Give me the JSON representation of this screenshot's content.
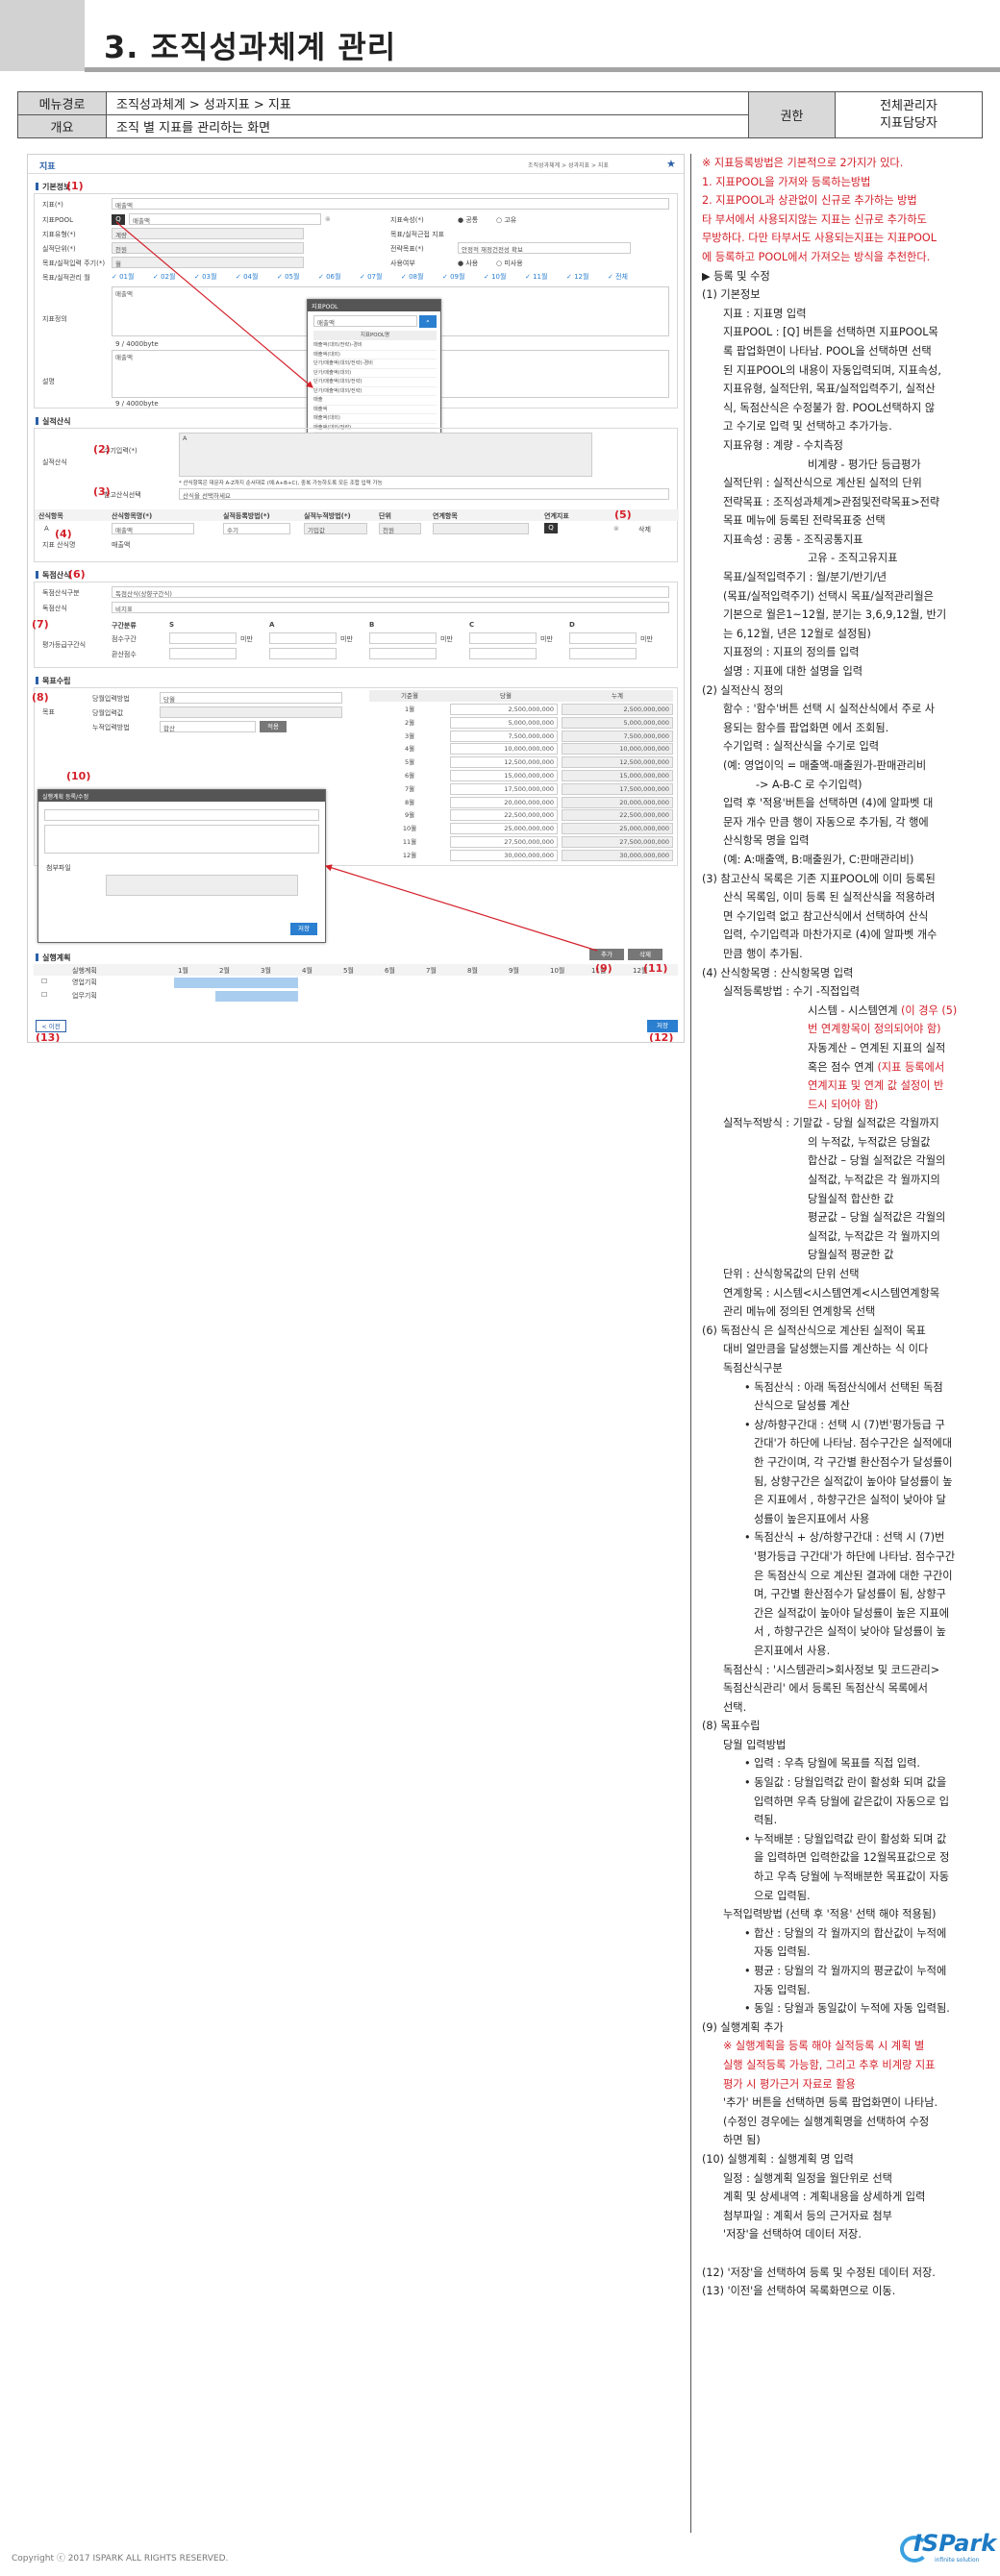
{
  "header": {
    "title": "3. 조직성과체계 관리"
  },
  "meta": {
    "path_label": "메뉴경로",
    "path_value": "조직성과체계 > 성과지표 > 지표",
    "overview_label": "개요",
    "overview_value": "조직 별 지표를 관리하는 화면",
    "auth_label": "권한",
    "auth_value_1": "전체관리자",
    "auth_value_2": "지표담당자"
  },
  "screen": {
    "title": "지표",
    "breadcrumb": "조직성과체계  >  성과지표  >  지표",
    "sections": {
      "basic": "기본정보",
      "calc": "실적산식",
      "formula": "독점산식",
      "goal": "목표수립",
      "plan": "실행계획"
    },
    "basic": {
      "kpi_label": "지표(*)",
      "kpi_value": "매출액",
      "pool_label": "지표POOL",
      "pool_value": "매출액",
      "type_label": "지표유형(*)",
      "type_value": "계량",
      "unit_label": "실적단위(*)",
      "unit_value": "천원",
      "cycle_label": "목표/실적입력 주기(*)",
      "cycle_value": "월",
      "months_label": "목표/실적관리 월",
      "months": [
        "01월",
        "02월",
        "03월",
        "04월",
        "05월",
        "06월",
        "07월",
        "08월",
        "09월",
        "10월",
        "11월",
        "12월",
        "전체"
      ],
      "attr_label": "지표속성(*)",
      "attr_opt1": "공통",
      "attr_opt2": "고유",
      "goal_kpi_label": "목표/실적근접 지표",
      "strategy_label": "전략목표(*)",
      "strategy_value": "안정적 재정건전성 확보",
      "use_label": "사용여부",
      "use_opt1": "사용",
      "use_opt2": "미사용",
      "def_label": "지표정의",
      "def_value": "매출액",
      "def_count": "9 / 4000byte",
      "desc_label": "설명",
      "desc_value": "매출액",
      "desc_count": "9 / 4000byte"
    },
    "pool_popup": {
      "title": "지표POOL",
      "search": "매출액",
      "col": "지표POOL명",
      "rows": [
        "매출액(대외/전략)-경비",
        "매출액(대외)",
        "단가/매출액(대외/전략)-경비",
        "단가/매출액(대외)",
        "단가/매출액(대외/전략)",
        "단가/매출액(대외/전략)",
        "매출",
        "매출액",
        "매출액(대외)",
        "매출액(대외/전략)",
        "매출액(전략)",
        "매출액증가율",
        "매출원가",
        "매출총이익"
      ]
    },
    "calc": {
      "calc_label": "실적산식",
      "calc_num": "(2)",
      "calc_sublabel": "수기입력(*)",
      "calc_value": "A",
      "calc_note": "* 산식항목은 대문자 A-Z까지 순서대로 (예:A+B+C), 중복 가능하도록 모든 조합 입력 가능",
      "ref_sublabel": "참고산식선택",
      "ref_value": "산식을 선택하세요",
      "headers": [
        "산식항목",
        "산식항목명(*)",
        "실적등록방법(*)",
        "실적누적방법(*)",
        "단위",
        "연계항목",
        "연계지표"
      ],
      "row": [
        "A",
        "매출액",
        "수기",
        "기입값",
        "천원",
        "",
        "",
        "삭제"
      ],
      "unit_label": "지표 산식명",
      "unit_value": "매출액"
    },
    "formula": {
      "type_label": "독점산식구분",
      "type_value": "독점산식(상향구간식)",
      "name_label": "독점산식",
      "name_value": "비지표",
      "band_label": "평가등급구간식",
      "band_cols": [
        "구간분류",
        "S",
        "A",
        "B",
        "C",
        "D"
      ],
      "band_rows": [
        "점수구간",
        "환산점수"
      ],
      "band_unit": "미만"
    },
    "goal": {
      "label": "목표",
      "method_label": "당월입력방법",
      "method_value": "당월",
      "actual_label": "당월입력값",
      "accum_label": "누적입력방법",
      "accum_value": "합산",
      "apply": "적용",
      "grid_headers": [
        "기준월",
        "당월",
        "누계"
      ],
      "rows": [
        [
          "1월",
          "2,500,000,000",
          "2,500,000,000"
        ],
        [
          "2월",
          "5,000,000,000",
          "5,000,000,000"
        ],
        [
          "3월",
          "7,500,000,000",
          "7,500,000,000"
        ],
        [
          "4월",
          "10,000,000,000",
          "10,000,000,000"
        ],
        [
          "5월",
          "12,500,000,000",
          "12,500,000,000"
        ],
        [
          "6월",
          "15,000,000,000",
          "15,000,000,000"
        ],
        [
          "7월",
          "17,500,000,000",
          "17,500,000,000"
        ],
        [
          "8월",
          "20,000,000,000",
          "20,000,000,000"
        ],
        [
          "9월",
          "22,500,000,000",
          "22,500,000,000"
        ],
        [
          "10월",
          "25,000,000,000",
          "25,000,000,000"
        ],
        [
          "11월",
          "27,500,000,000",
          "27,500,000,000"
        ],
        [
          "12월",
          "30,000,000,000",
          "30,000,000,000"
        ]
      ]
    },
    "plan_popup": {
      "title": "실행계획 등록/수정",
      "save": "저장",
      "attach": "첨부파일"
    },
    "plan": {
      "add": "추가",
      "del": "삭제",
      "name_col": "실행계획",
      "months": [
        "1월",
        "2월",
        "3월",
        "4월",
        "5월",
        "6월",
        "7월",
        "8월",
        "9월",
        "10월",
        "11월",
        "12월"
      ],
      "rows": [
        "영업기획",
        "업무기획"
      ],
      "prev": "< 이전",
      "save": "저장"
    },
    "ann": {
      "a1": "(1)",
      "a2": "(2)",
      "a3": "(3)",
      "a4": "(4)",
      "a5": "(5)",
      "a6": "(6)",
      "a7": "(7)",
      "a8": "(8)",
      "a9": "(9)",
      "a10": "(10)",
      "a11": "(11)",
      "a12": "(12)",
      "a13": "(13)"
    }
  },
  "desc": [
    {
      "t": "※ 지표등록방법은 기본적으로 2가지가 있다.",
      "c": "rd"
    },
    {
      "t": "1.    지표POOL을 가져와 등록하는방법",
      "c": "rd"
    },
    {
      "t": "2.    지표POOL과 상관없이 신규로 추가하는 방법",
      "c": "rd"
    },
    {
      "t": "타 부서에서 사용되지않는 지표는 신규로 추가하도",
      "c": "rd"
    },
    {
      "t": "무방하다. 다만 타부서도 사용되는지표는 지표POOL",
      "c": "rd"
    },
    {
      "t": "에 등록하고 POOL에서 가져오는 방식을 추천한다.",
      "c": "rd"
    },
    {
      "t": "▶ 등록 및 수정",
      "c": ""
    },
    {
      "t": "(1)  기본정보",
      "c": ""
    },
    {
      "t": "지표 : 지표명 입력",
      "c": "ind1"
    },
    {
      "t": "지표POOL :  [Q]  버튼을 선택하면 지표POOL목",
      "c": "ind1"
    },
    {
      "t": "록 팝업화면이 나타남.  POOL을 선택하면 선택",
      "c": "ind1"
    },
    {
      "t": "된 지표POOL의 내용이 자동입력되며, 지표속성,",
      "c": "ind1"
    },
    {
      "t": "지표유형, 실적단위, 목표/실적입력주기, 실적산",
      "c": "ind1"
    },
    {
      "t": "식, 독점산식은 수정불가 함. POOL선택하지 않",
      "c": "ind1"
    },
    {
      "t": "고 수기로 입력 및 선택하고 추가가능.",
      "c": "ind1"
    },
    {
      "t": "지표유형 : 계량 - 수치측정",
      "c": "ind1"
    },
    {
      "t": "비계량 - 평가단 등급평가",
      "c": "ind3x"
    },
    {
      "t": "실적단위 : 실적산식으로 계산된 실적의 단위",
      "c": "ind1"
    },
    {
      "t": "전략목표 : 조직성과체계>관점및전략목표>전략",
      "c": "ind1"
    },
    {
      "t": "목표 메뉴에 등록된 전략목표중 선택",
      "c": "ind1"
    },
    {
      "t": "지표속성 : 공통 - 조직공통지표",
      "c": "ind1"
    },
    {
      "t": "고유 - 조직고유지표",
      "c": "ind3x"
    },
    {
      "t": "목표/실적입력주기 : 월/분기/반기/년",
      "c": "ind1"
    },
    {
      "t": "(목표/실적입력주기) 선택시 목표/실적관리월은",
      "c": "ind1"
    },
    {
      "t": "기본으로 월은1~12월, 분기는 3,6,9,12월, 반기",
      "c": "ind1"
    },
    {
      "t": "는 6,12월, 년은 12월로 설정됨)",
      "c": "ind1"
    },
    {
      "t": "지표정의 : 지표의 정의를 입력",
      "c": "ind1"
    },
    {
      "t": "설명 : 지표에 대한 설명을 입력",
      "c": "ind1"
    },
    {
      "t": "(2)  실적산식 정의",
      "c": ""
    },
    {
      "t": "함수 : '함수'버튼 선택 시 실적산식에서 주로 사",
      "c": "ind1"
    },
    {
      "t": "용되는 함수를 팝업화면 에서 조회됨.",
      "c": "ind1"
    },
    {
      "t": "수기입력 : 실적산식을 수기로 입력",
      "c": "ind1"
    },
    {
      "t": "(예: 영업이익 = 매출액-매출원가-판매관리비",
      "c": "ind1"
    },
    {
      "t": "-> A-B-C 로 수기입력)",
      "c": "ind3"
    },
    {
      "t": "입력 후 '적용'버튼을 선택하면 (4)에 알파벳 대",
      "c": "ind1"
    },
    {
      "t": "문자 개수 만큼 행이 자동으로 추가됨, 각 행에",
      "c": "ind1"
    },
    {
      "t": "산식항목 명을 입력",
      "c": "ind1"
    },
    {
      "t": "(예: A:매출액, B:매출원가, C:판매관리비)",
      "c": "ind1"
    },
    {
      "t": "(3)  참고산식 목록은 기존 지표POOL에 이미 등록된",
      "c": ""
    },
    {
      "t": "산식 목록임, 이미 등록 된 실적산식을 적용하려",
      "c": "ind1"
    },
    {
      "t": "면 수기입력 없고 참고산식에서 선택하여 산식",
      "c": "ind1"
    },
    {
      "t": "입력, 수기입력과 마찬가지로 (4)에 알파벳 개수",
      "c": "ind1"
    },
    {
      "t": "만큼 행이 추가됨.",
      "c": "ind1"
    },
    {
      "t": "(4)  산식항목명 : 산식항목명 입력",
      "c": ""
    },
    {
      "t": "실적등록방법 : 수기 -직접입력",
      "c": "ind1"
    },
    {
      "t": "시스템 - 시스템연계 (이 경우 (5)",
      "c": "ind4",
      "r": "(이 경우 (5)"
    },
    {
      "t": "번 연계항목이 정의되어야 함)",
      "c": "ind4 rd"
    },
    {
      "t": "자동계산 – 연계된 지표의 실적",
      "c": "ind4"
    },
    {
      "t": "혹은 점수 연계 (지표 등록에서",
      "c": "ind4",
      "r": "(지표 등록에서"
    },
    {
      "t": "연계지표 및 연계 값 설정이 반",
      "c": "ind4 rd"
    },
    {
      "t": "드시 되어야 함)",
      "c": "ind4 rd"
    },
    {
      "t": "실적누적방식 : 기말값 - 당월 실적값은 각월까지",
      "c": "ind1"
    },
    {
      "t": "의 누적값, 누적값은 당월값",
      "c": "ind4"
    },
    {
      "t": "합산값 – 당월 실적값은  각월의",
      "c": "ind4"
    },
    {
      "t": "실적값, 누적값은 각 월까지의",
      "c": "ind4"
    },
    {
      "t": "당월실적  합산한 값",
      "c": "ind4"
    },
    {
      "t": "평균값 – 당월 실적값은  각월의",
      "c": "ind4"
    },
    {
      "t": "실적값, 누적값은 각 월까지의",
      "c": "ind4"
    },
    {
      "t": "당월실적  평균한 값",
      "c": "ind4"
    },
    {
      "t": "단위 : 산식항목값의 단위 선택",
      "c": "ind1"
    },
    {
      "t": "연계항목 : 시스템<시스템연계<시스템연계항목",
      "c": "ind1"
    },
    {
      "t": "관리 메뉴에 정의된 연계항목 선택",
      "c": "ind1"
    },
    {
      "t": "(6)  독점산식 은 실적산식으로 계산된 실적이 목표",
      "c": ""
    },
    {
      "t": "대비 얼만큼을 달성했는지를 계산하는 식 이다",
      "c": "ind1"
    },
    {
      "t": "독점산식구분",
      "c": "ind1"
    },
    {
      "t": "• 독점산식 : 아래 독점산식에서 선택된 독점",
      "c": "ind2"
    },
    {
      "t": "산식으로 달성률 계산",
      "c": "ind2x"
    },
    {
      "t": "• 상/하향구간대 : 선택 시 (7)번'평가등급 구",
      "c": "ind2"
    },
    {
      "t": "간대'가 하단에 나타남. 점수구간은 실적에대",
      "c": "ind2x"
    },
    {
      "t": "한 구간이며, 각 구간별 환산점수가 달성률이",
      "c": "ind2x"
    },
    {
      "t": "됨, 상향구간은 실적값이 높아야 달성률이 높",
      "c": "ind2x"
    },
    {
      "t": "은 지표에서 , 하향구간은 실적이 낮아야 달",
      "c": "ind2x"
    },
    {
      "t": "성률이 높은지표에서 사용",
      "c": "ind2x"
    },
    {
      "t": "• 독점산식 + 상/하향구간대 : 선택 시 (7)번",
      "c": "ind2"
    },
    {
      "t": "'평가등급 구간대'가 하단에 나타남. 점수구간",
      "c": "ind2x"
    },
    {
      "t": "은 독점산식 으로 계산된 결과에 대한 구간이",
      "c": "ind2x"
    },
    {
      "t": "며, 구간별 환산점수가 달성률이 됨, 상향구",
      "c": "ind2x"
    },
    {
      "t": "간은 실적값이 높아야 달성률이 높은 지표에",
      "c": "ind2x"
    },
    {
      "t": "서 , 하향구간은 실적이 낮아야 달성률이 높",
      "c": "ind2x"
    },
    {
      "t": "은지표에서 사용.",
      "c": "ind2x"
    },
    {
      "t": "독점산식 : '시스템관리>회사정보 및 코드관리>",
      "c": "ind1"
    },
    {
      "t": "독점산식관리' 에서 등록된 독점산식 목록에서",
      "c": "ind1"
    },
    {
      "t": "선택.",
      "c": "ind1"
    },
    {
      "t": "(8)  목표수립",
      "c": ""
    },
    {
      "t": "당월 입력방법",
      "c": "ind1"
    },
    {
      "t": "• 입력 : 우측 당월에 목표를 직접 입력.",
      "c": "ind2"
    },
    {
      "t": "• 동일값 : 당월입력값 란이 활성화 되며 값을",
      "c": "ind2"
    },
    {
      "t": "입력하면 우측 당월에 같은값이 자동으로 입",
      "c": "ind2x"
    },
    {
      "t": "력됨.",
      "c": "ind2x"
    },
    {
      "t": "• 누적배분 : 당월입력값 란이 활성화 되며 값",
      "c": "ind2"
    },
    {
      "t": "을 입력하면 입력한값을 12월목표값으로 정",
      "c": "ind2x"
    },
    {
      "t": "하고 우측 당월에 누적배분한 목표값이 자동",
      "c": "ind2x"
    },
    {
      "t": "으로 입력됨.",
      "c": "ind2x"
    },
    {
      "t": "누적입력방법 (선택 후 '적용' 선택 해야 적용됨)",
      "c": "ind1"
    },
    {
      "t": "• 합산 : 당월의 각 월까지의 합산값이 누적에",
      "c": "ind2"
    },
    {
      "t": "자동 입력됨.",
      "c": "ind2x"
    },
    {
      "t": "• 평균 : 당월의 각 월까지의 평균값이 누적에",
      "c": "ind2"
    },
    {
      "t": "자동 입력됨.",
      "c": "ind2x"
    },
    {
      "t": "• 동일 : 당월과 동일값이 누적에 자동 입력됨.",
      "c": "ind2"
    },
    {
      "t": "(9)  실행계획 추가",
      "c": ""
    },
    {
      "t": "※ 실행계획을 등록 해야 실적등록 시 계획 별",
      "c": "ind1 rd"
    },
    {
      "t": "실행 실적등록 가능함, 그리고 추후 비계량 지표",
      "c": "ind1 rd"
    },
    {
      "t": "평가 시 평가근거 자료로 활용",
      "c": "ind1 rd"
    },
    {
      "t": "'추가' 버튼을 선택하면 등록 팝업화면이 나타남.",
      "c": "ind1"
    },
    {
      "t": "(수정인 경우에는 실행계획명을 선택하여 수정",
      "c": "ind1"
    },
    {
      "t": "하면 됨)",
      "c": "ind1"
    },
    {
      "t": "(10) 실행계획 : 실행계획 명 입력",
      "c": ""
    },
    {
      "t": "일정 : 실행계획 일정을 월단위로 선택",
      "c": "ind1"
    },
    {
      "t": "계획 및 상세내역 : 계획내용을 상세하게 입력",
      "c": "ind1"
    },
    {
      "t": "첨부파일 : 계획서 등의 근거자료 첨부",
      "c": "ind1"
    },
    {
      "t": "'저장'을 선택하여 데이터 저장.",
      "c": "ind1"
    },
    {
      "t": "",
      "c": ""
    },
    {
      "t": "(12) '저장'을 선택하여 등록 및 수정된 데이터 저장.",
      "c": ""
    },
    {
      "t": "(13) '이전'을 선택하여 목록화면으로 이동.",
      "c": ""
    }
  ],
  "footer": {
    "copyright": "Copyright ⓒ 2017 ISPARK ALL RIGHTS RESERVED.",
    "logo": "ISPark",
    "logo_sub": "infinite solution"
  }
}
